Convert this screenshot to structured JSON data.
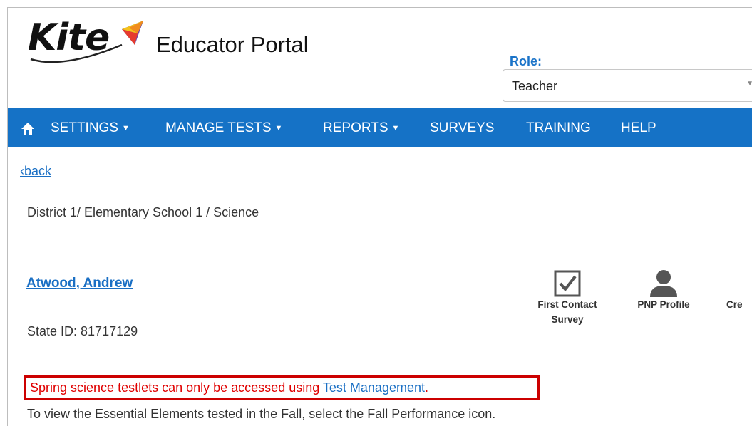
{
  "header": {
    "logo_text": "Kite",
    "portal_title": "Educator Portal",
    "role_label": "Role:",
    "role_value": "Teacher"
  },
  "nav": {
    "items": [
      {
        "label": "SETTINGS",
        "dropdown": true
      },
      {
        "label": "MANAGE TESTS",
        "dropdown": true
      },
      {
        "label": "REPORTS",
        "dropdown": true
      },
      {
        "label": "SURVEYS",
        "dropdown": false
      },
      {
        "label": "TRAINING",
        "dropdown": false
      },
      {
        "label": "HELP",
        "dropdown": false
      }
    ],
    "caret": "▼"
  },
  "content": {
    "back_link": "‹back",
    "breadcrumb": "District 1/ Elementary School 1 / Science",
    "student_name": "Atwood, Andrew",
    "state_id": "State ID: 81717129",
    "tools": [
      {
        "label_line1": "First Contact",
        "label_line2": "Survey",
        "icon": "checkbox-icon"
      },
      {
        "label_line1": "PNP Profile",
        "label_line2": "",
        "icon": "person-icon"
      },
      {
        "label_line1": "Cre",
        "label_line2": "",
        "icon": ""
      }
    ],
    "alert_text": "Spring science testlets can only be accessed using ",
    "alert_link": "Test Management",
    "alert_suffix": ".",
    "info_text": "To view the Essential Elements tested in the Fall, select the Fall Performance icon."
  },
  "colors": {
    "nav_bg": "#1572c6",
    "link": "#1a6fc4",
    "alert_red": "#e00000",
    "alert_border": "#cc0000"
  }
}
